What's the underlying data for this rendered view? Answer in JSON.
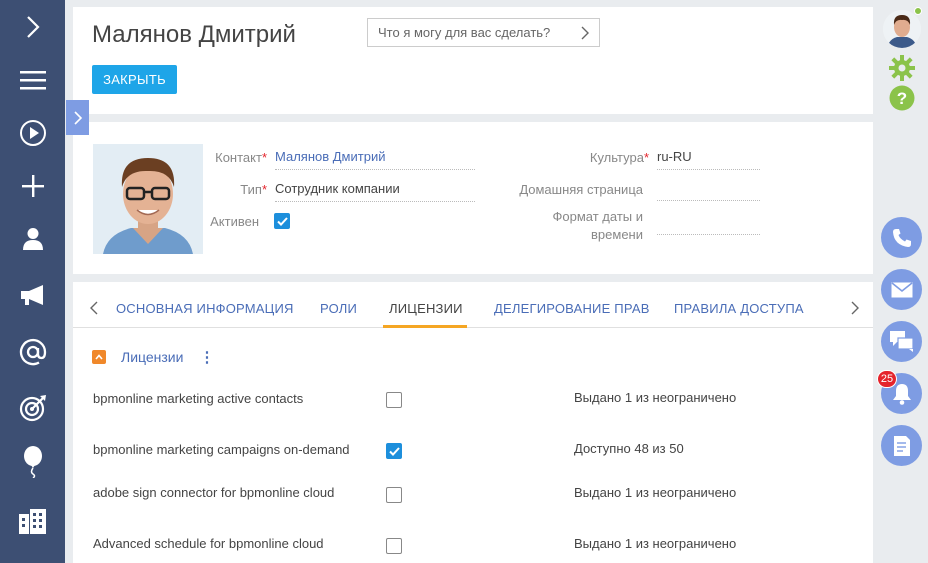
{
  "header": {
    "title": "Малянов Дмитрий",
    "command_placeholder": "Что я могу для вас сделать?",
    "close_label": "ЗАКРЫТЬ"
  },
  "contact": {
    "contact_label": "Контакт",
    "contact_value": "Малянов Дмитрий",
    "type_label": "Тип",
    "type_value": "Сотрудник компании",
    "active_label": "Активен",
    "active_checked": true,
    "culture_label": "Культура",
    "culture_value": "ru-RU",
    "homepage_label": "Домашняя страница",
    "homepage_value": "",
    "date_format_label_1": "Формат даты и",
    "date_format_label_2": "времени",
    "date_format_value": "",
    "required_mark": "*"
  },
  "tabs": [
    {
      "label": "ОСНОВНАЯ ИНФОРМАЦИЯ",
      "active": false
    },
    {
      "label": "РОЛИ",
      "active": false
    },
    {
      "label": "ЛИЦЕНЗИИ",
      "active": true
    },
    {
      "label": "ДЕЛЕГИРОВАНИЕ ПРАВ",
      "active": false
    },
    {
      "label": "ПРАВИЛА ДОСТУПА",
      "active": false
    }
  ],
  "licenses_section": {
    "title": "Лицензии",
    "menu_glyph": "⋮",
    "rows": [
      {
        "name": "bpmonline marketing active contacts",
        "checked": false,
        "status": "Выдано 1 из неограничено"
      },
      {
        "name": "bpmonline marketing campaigns on-demand",
        "checked": true,
        "status": "Доступно 48 из 50"
      },
      {
        "name": "adobe sign connector for bpmonline cloud",
        "checked": false,
        "status": "Выдано 1 из неограничено"
      },
      {
        "name": "Advanced schedule for bpmonline cloud",
        "checked": false,
        "status": "Выдано 1 из неограничено"
      }
    ]
  },
  "right_bar": {
    "notification_count": "25"
  },
  "colors": {
    "sidebar": "#3d4f73",
    "accent_blue": "#1ea5e8",
    "link_blue": "#4a6db7",
    "tab_underline": "#f5a623",
    "round_button": "#7e9ce3",
    "green_icon": "#8bc34a"
  },
  "icons": {
    "left_bar": [
      "chevron-right-icon",
      "menu-icon",
      "play-icon",
      "plus-icon",
      "user-icon",
      "megaphone-icon",
      "at-icon",
      "target-icon",
      "balloon-icon",
      "buildings-icon"
    ],
    "right_bar": [
      "avatar",
      "gear-icon",
      "help-icon",
      "phone-icon",
      "mail-icon",
      "chat-icon",
      "bell-icon",
      "document-icon"
    ]
  }
}
